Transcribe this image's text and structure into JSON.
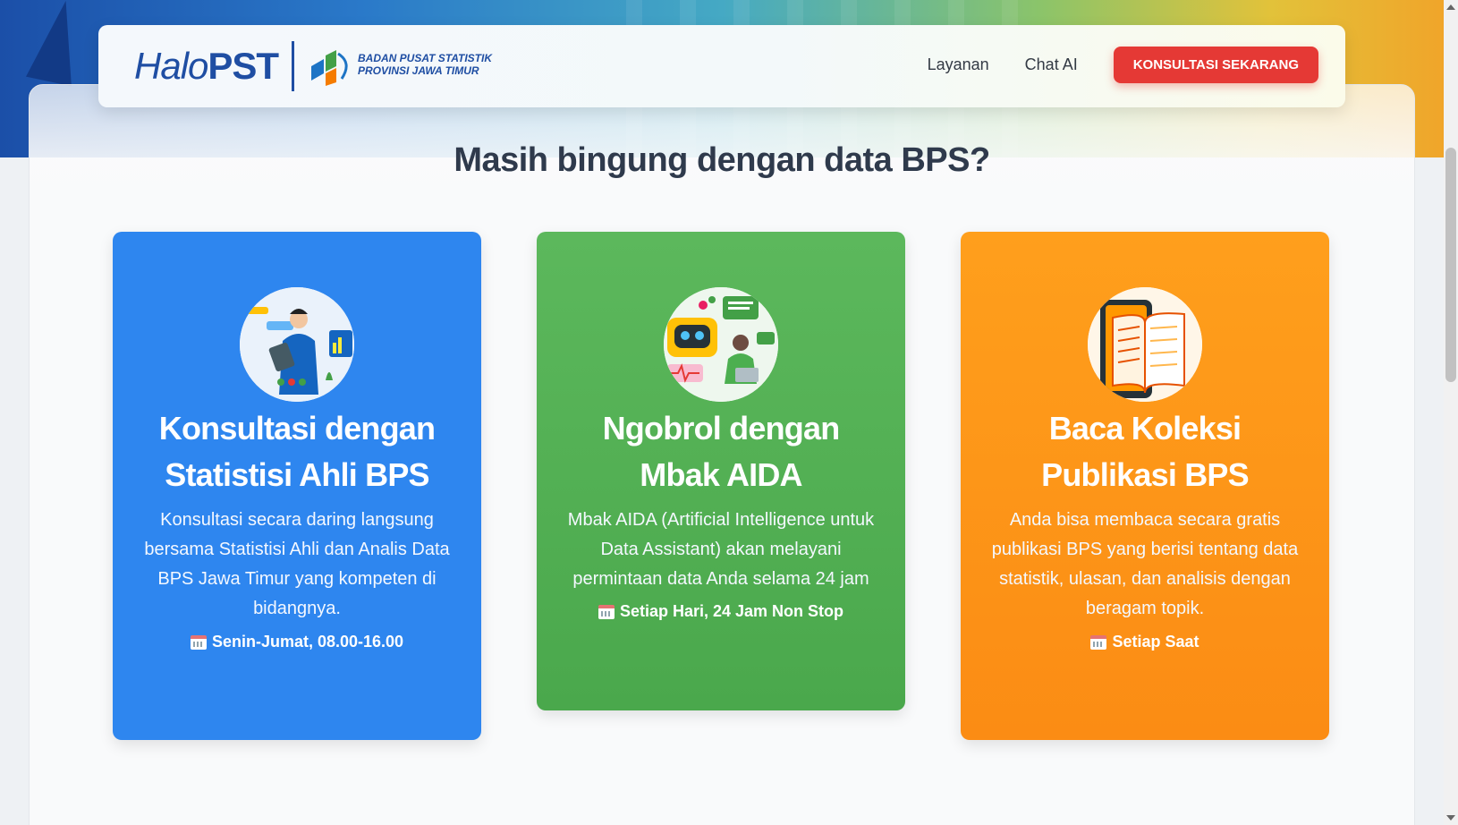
{
  "header": {
    "logo_halo": "Halo",
    "logo_pst": "PST",
    "bps_line1": "BADAN PUSAT STATISTIK",
    "bps_line2": "PROVINSI JAWA TIMUR",
    "nav": [
      {
        "label": "Layanan"
      },
      {
        "label": "Chat AI"
      }
    ],
    "cta_label": "KONSULTASI SEKARANG"
  },
  "main": {
    "title": "Masih bingung dengan data BPS?",
    "cards": [
      {
        "title": "Konsultasi dengan\nStatistisi Ahli BPS",
        "description": "Konsultasi secara daring langsung bersama Statistisi Ahli dan Analis Data BPS Jawa Timur yang kompeten di bidangnya.",
        "schedule": "Senin-Jumat, 08.00-16.00",
        "icon": "consultant-illustration-icon",
        "color": "#2e86ef"
      },
      {
        "title": "Ngobrol dengan\nMbak AIDA",
        "description": "Mbak AIDA (Artificial Intelligence untuk Data Assistant) akan melayani permintaan data Anda selama 24 jam",
        "schedule": "Setiap Hari, 24 Jam Non Stop",
        "icon": "chatbot-illustration-icon",
        "color": "#5cb85c"
      },
      {
        "title": "Baca Koleksi\nPublikasi BPS",
        "description": "Anda bisa membaca secara gratis publikasi BPS yang berisi tentang data statistik, ulasan, dan analisis dengan beragam topik.",
        "schedule": "Setiap Saat",
        "icon": "book-illustration-icon",
        "color": "#ff9f1c"
      }
    ]
  },
  "colors": {
    "brand_blue": "#1f4ea3",
    "cta_red": "#e53935",
    "title_text": "#2f3a4c"
  }
}
